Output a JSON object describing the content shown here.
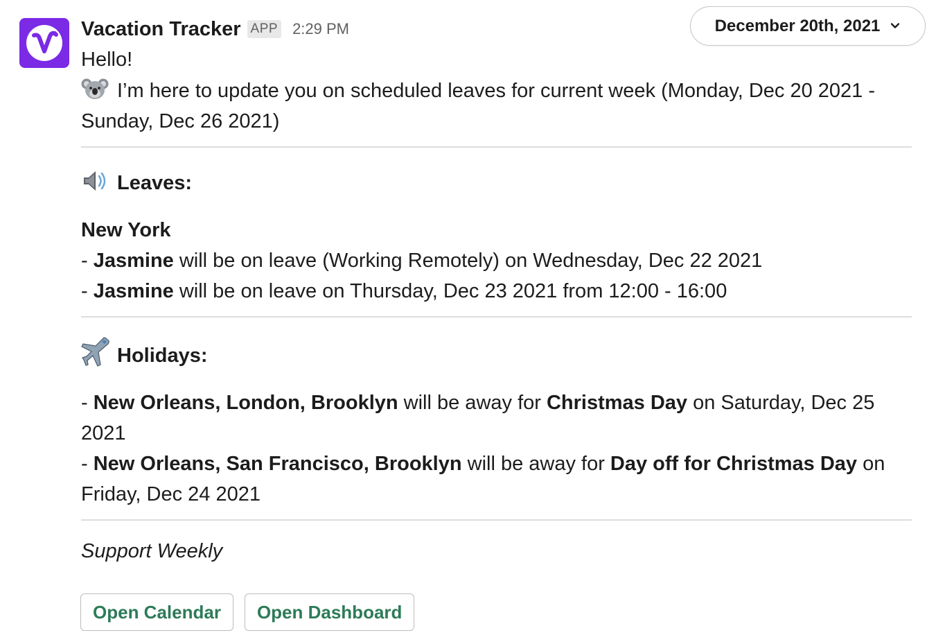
{
  "message": {
    "sender": "Vacation Tracker",
    "badge": "APP",
    "time": "2:29 PM",
    "date_selector": "December 20th, 2021",
    "greeting": "Hello!",
    "intro_line1": "I’m here to update you on scheduled leaves for current week (Monday, Dec 20 2021 -",
    "intro_line2": "Sunday, Dec 26 2021)",
    "leaves": {
      "heading": "Leaves:",
      "location": "New York",
      "entries": [
        {
          "prefix": "- ",
          "name": "Jasmine",
          "text": " will be on leave (Working Remotely) on Wednesday, Dec 22 2021"
        },
        {
          "prefix": "- ",
          "name": "Jasmine",
          "text": " will be on leave  on Thursday, Dec 23 2021 from 12:00 - 16:00"
        }
      ]
    },
    "holidays": {
      "heading": "Holidays:",
      "entries": [
        {
          "prefix": "- ",
          "places": "New Orleans, London, Brooklyn",
          "mid": " will be away for ",
          "holiday": "Christmas Day",
          "tail1": " on Saturday, Dec 25",
          "tail2": "2021"
        },
        {
          "prefix": "- ",
          "places": "New Orleans, San Francisco, Brooklyn",
          "mid": " will be away for ",
          "holiday": "Day off for Christmas Day",
          "tail1": " on",
          "tail2": "Friday, Dec 24 2021"
        }
      ]
    },
    "footer_note": "Support Weekly",
    "buttons": {
      "calendar": "Open Calendar",
      "dashboard": "Open Dashboard"
    }
  },
  "colors": {
    "avatar_bg": "#7b2ae6",
    "button_text": "#2d7b58",
    "divider": "#dddddd"
  },
  "icons": [
    "vacation-tracker-logo-icon",
    "koala-emoji-icon",
    "speaker-emoji-icon",
    "airplane-emoji-icon",
    "chevron-down-icon"
  ]
}
